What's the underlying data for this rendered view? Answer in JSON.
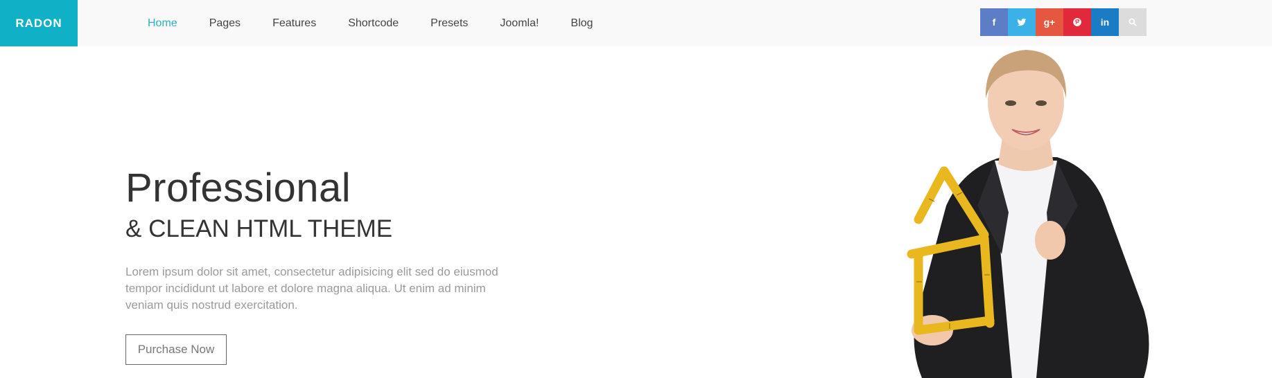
{
  "header": {
    "logo": "RADON",
    "nav": [
      {
        "label": "Home",
        "active": true
      },
      {
        "label": "Pages"
      },
      {
        "label": "Features"
      },
      {
        "label": "Shortcode"
      },
      {
        "label": "Presets"
      },
      {
        "label": "Joomla!"
      },
      {
        "label": "Blog"
      }
    ],
    "social": [
      {
        "icon": "facebook-icon",
        "glyph": "f",
        "color": "#5d7ec6"
      },
      {
        "icon": "twitter-icon",
        "glyph": "t",
        "color": "#3ab2e8"
      },
      {
        "icon": "google-plus-icon",
        "glyph": "g+",
        "color": "#e5573f"
      },
      {
        "icon": "pinterest-icon",
        "glyph": "p",
        "color": "#e2283b"
      },
      {
        "icon": "linkedin-icon",
        "glyph": "in",
        "color": "#1a7cc4"
      },
      {
        "icon": "search-icon",
        "glyph": "",
        "color": "#dcdcdc"
      }
    ]
  },
  "hero": {
    "title": "Professional",
    "subtitle": "& CLEAN HTML THEME",
    "text": "Lorem ipsum dolor sit amet, consectetur adipisicing elit sed do eiusmod tempor incididunt ut labore et dolore magna aliqua. Ut enim ad minim veniam quis nostrud exercitation.",
    "button": "Purchase Now"
  },
  "colors": {
    "brand": "#10b0c6",
    "nav_active": "#2cb2c4"
  }
}
